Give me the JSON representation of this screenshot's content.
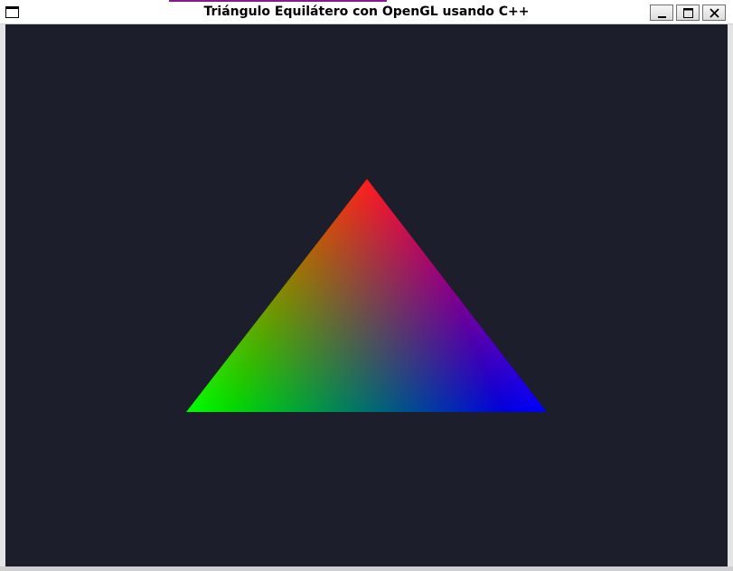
{
  "window": {
    "title": "Triángulo Equilátero con OpenGL usando C++",
    "controls": {
      "minimize_icon": "minimize-icon",
      "maximize_icon": "maximize-icon",
      "close_icon": "close-icon"
    }
  },
  "scene": {
    "background_color": "#1c1f2b",
    "shape": "triangle",
    "vertex_colors": {
      "top": "#ff0000",
      "bottom_left": "#00ff00",
      "bottom_right": "#0000ff"
    }
  }
}
